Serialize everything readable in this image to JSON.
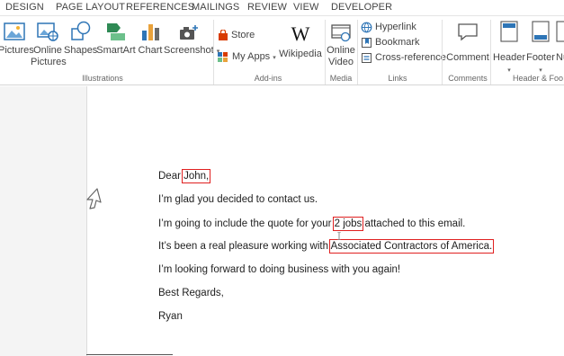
{
  "tabs": [
    "DESIGN",
    "PAGE LAYOUT",
    "REFERENCES",
    "MAILINGS",
    "REVIEW",
    "VIEW",
    "DEVELOPER"
  ],
  "illustrations": {
    "pictures": "Pictures",
    "online_pictures_1": "Online",
    "online_pictures_2": "Pictures",
    "shapes": "Shapes",
    "smartart": "SmartArt",
    "chart": "Chart",
    "screenshot": "Screenshot",
    "group_label": "Illustrations"
  },
  "addins": {
    "store": "Store",
    "my_apps": "My Apps",
    "wikipedia": "Wikipedia",
    "group_label": "Add-ins"
  },
  "media": {
    "online_video_1": "Online",
    "online_video_2": "Video",
    "group_label": "Media"
  },
  "links": {
    "hyperlink": "Hyperlink",
    "bookmark": "Bookmark",
    "cross_reference": "Cross-reference",
    "group_label": "Links"
  },
  "comments": {
    "comment": "Comment",
    "group_label": "Comments"
  },
  "header_footer": {
    "header": "Header",
    "footer": "Footer",
    "nu": "Nu",
    "group_label": "Header & Foo"
  },
  "letter": {
    "line1_prefix": "Dear ",
    "line1_field": "John,",
    "line2": "I’m glad you decided to contact us.",
    "line3_prefix": "I’m going to include the quote for your ",
    "line3_field": "2 jobs",
    "line3_suffix": " attached to this email.",
    "line4_prefix": "It’s been a real pleasure working with ",
    "line4_field": "Associated Contractors of America.",
    "line5": "I’m looking forward to doing business with you again!",
    "line6": "Best Regards,",
    "line7": "Ryan"
  },
  "colors": {
    "highlight_border": "#e02020",
    "store_red": "#d83b01",
    "picture_blue": "#2e75b6"
  }
}
